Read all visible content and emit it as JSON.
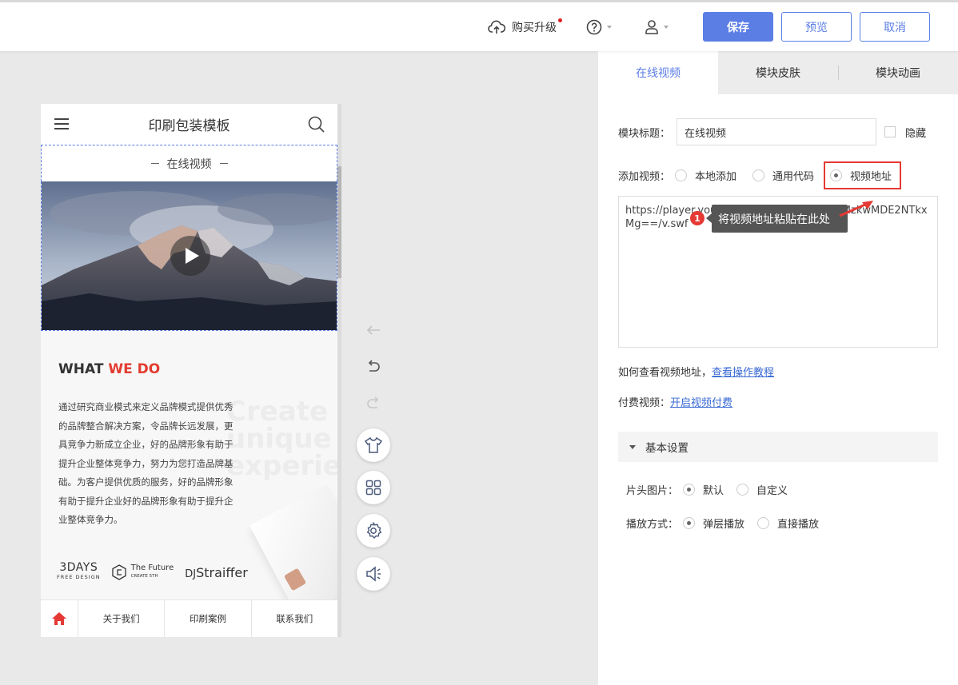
{
  "topbar": {
    "upgrade_label": "购买升级",
    "save_label": "保存",
    "preview_label": "预览",
    "cancel_label": "取消"
  },
  "phone": {
    "site_title": "印刷包装模板",
    "module_title": "在线视频",
    "what_we_do": {
      "part1": "WHAT ",
      "part2": "WE DO"
    },
    "bg_text": [
      "Create",
      "unique user",
      "experience"
    ],
    "paragraph": "通过研究商业模式来定义品牌模式提供优秀的品牌整合解决方案，令品牌长远发展，更具竞争力新成立企业，好的品牌形象有助于提升企业整体竞争力，努力为您打造品牌基础。为客户提供优质的服务，好的品牌形象有助于提升企业好的品牌形象有助于提升企业整体竞争力。",
    "logos": {
      "logo1_main": "3DAYS",
      "logo1_sub": "FREE DESIGN",
      "logo2_main": "The Future",
      "logo2_sub": "CREATE 5TH",
      "logo3": "Straiffer"
    },
    "nav": [
      "关于我们",
      "印刷案例",
      "联系我们"
    ]
  },
  "panel": {
    "tabs": [
      "在线视频",
      "模块皮肤",
      "模块动画"
    ],
    "module_title_label": "模块标题：",
    "module_title_value": "在线视频",
    "hide_label": "隐藏",
    "add_video_label": "添加视频：",
    "add_options": [
      "本地添加",
      "通用代码",
      "视频地址"
    ],
    "url_value": "https://player.youku.com/player.php/sid/XMzkwMDE2NTkxMg==/v.swf",
    "tooltip_badge": "1",
    "tooltip_text": "将视频地址粘贴在此处",
    "how_label": "如何查看视频地址，",
    "how_link": "查看操作教程",
    "paid_label": "付费视频：",
    "paid_link": "开启视频付费",
    "basic_settings": "基本设置",
    "cover_label": "片头图片：",
    "cover_options": [
      "默认",
      "自定义"
    ],
    "play_label": "播放方式：",
    "play_options": [
      "弹层播放",
      "直接播放"
    ]
  },
  "colors": {
    "accent": "#5b7ee5",
    "highlight": "#e53935",
    "brand_red": "#e33b2f"
  }
}
